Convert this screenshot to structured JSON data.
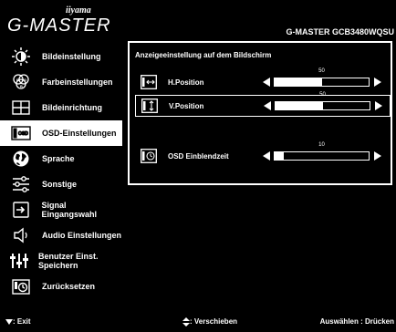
{
  "header": {
    "brand": "iiyama",
    "product_line": "G-MASTER",
    "model": "G-MASTER GCB3480WQSU"
  },
  "sidebar": {
    "items": [
      {
        "label": "Bildeinstellung",
        "icon": "brightness-icon"
      },
      {
        "label": "Farbeinstellungen",
        "icon": "color-icon"
      },
      {
        "label": "Bildeinrichtung",
        "icon": "image-setup-icon"
      },
      {
        "label": "OSD-Einstellungen",
        "icon": "osd-icon"
      },
      {
        "label": "Sprache",
        "icon": "globe-icon"
      },
      {
        "label": "Sonstige",
        "icon": "sliders-icon"
      },
      {
        "label": "Signal Eingangswahl",
        "icon": "input-icon"
      },
      {
        "label": "Audio Einstellungen",
        "icon": "speaker-icon"
      },
      {
        "label": "Benutzer Einst. Speichern",
        "icon": "user-save-icon"
      },
      {
        "label": "Zurücksetzen",
        "icon": "reset-icon"
      }
    ],
    "active_index": 3
  },
  "panel": {
    "title": "Anzeigeeinstellung auf dem Bildschirm",
    "settings": [
      {
        "label": "H.Position",
        "value": 50,
        "max": 100,
        "icon": "h-position-icon"
      },
      {
        "label": "V.Position",
        "value": 50,
        "max": 100,
        "icon": "v-position-icon",
        "selected": true
      },
      {
        "label": "OSD Einblendzeit",
        "value": 10,
        "max": 100,
        "icon": "timer-icon"
      }
    ]
  },
  "footer": {
    "exit": ": Exit",
    "move": ": Verschieben",
    "select": "Auswählen : Drücken"
  }
}
